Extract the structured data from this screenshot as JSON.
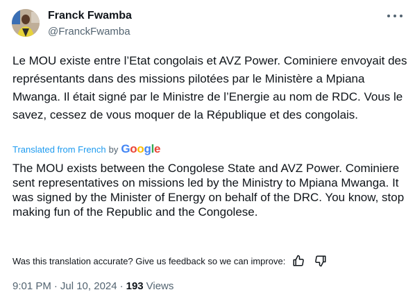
{
  "author": {
    "display_name": "Franck Fwamba",
    "handle": "@FranckFwamba"
  },
  "tweet": {
    "original_text": "Le MOU existe entre l’Etat congolais et AVZ Power. Cominiere envoyait des représentants dans des missions pilotées par le Ministère a Mpiana Mwanga. Il était signé par le Ministre de l’Energie au nom de RDC. Vous le savez, cessez de vous moquer de la République et des congolais.",
    "translated_from_label": "Translated from French",
    "by_label": "by",
    "google_letters": [
      "G",
      "o",
      "o",
      "g",
      "l",
      "e"
    ],
    "translated_text": "The MOU exists between the Congolese State and AVZ Power. Cominiere sent representatives on missions led by the Ministry to Mpiana Mwanga. It was signed by the Minister of Energy on behalf of the DRC. You know, stop making fun of the Republic and the Congolese.",
    "feedback_prompt": "Was this translation accurate? Give us feedback so we can improve:"
  },
  "meta": {
    "time": "9:01 PM",
    "separator": "·",
    "date": "Jul 10, 2024",
    "views_count": "193",
    "views_label": "Views"
  },
  "icons": {
    "more": "more-icon",
    "thumbs_up": "thumbs-up-icon",
    "thumbs_down": "thumbs-down-icon"
  },
  "colors": {
    "link": "#1d9bf0",
    "secondary": "#536471",
    "text": "#0f1419"
  }
}
